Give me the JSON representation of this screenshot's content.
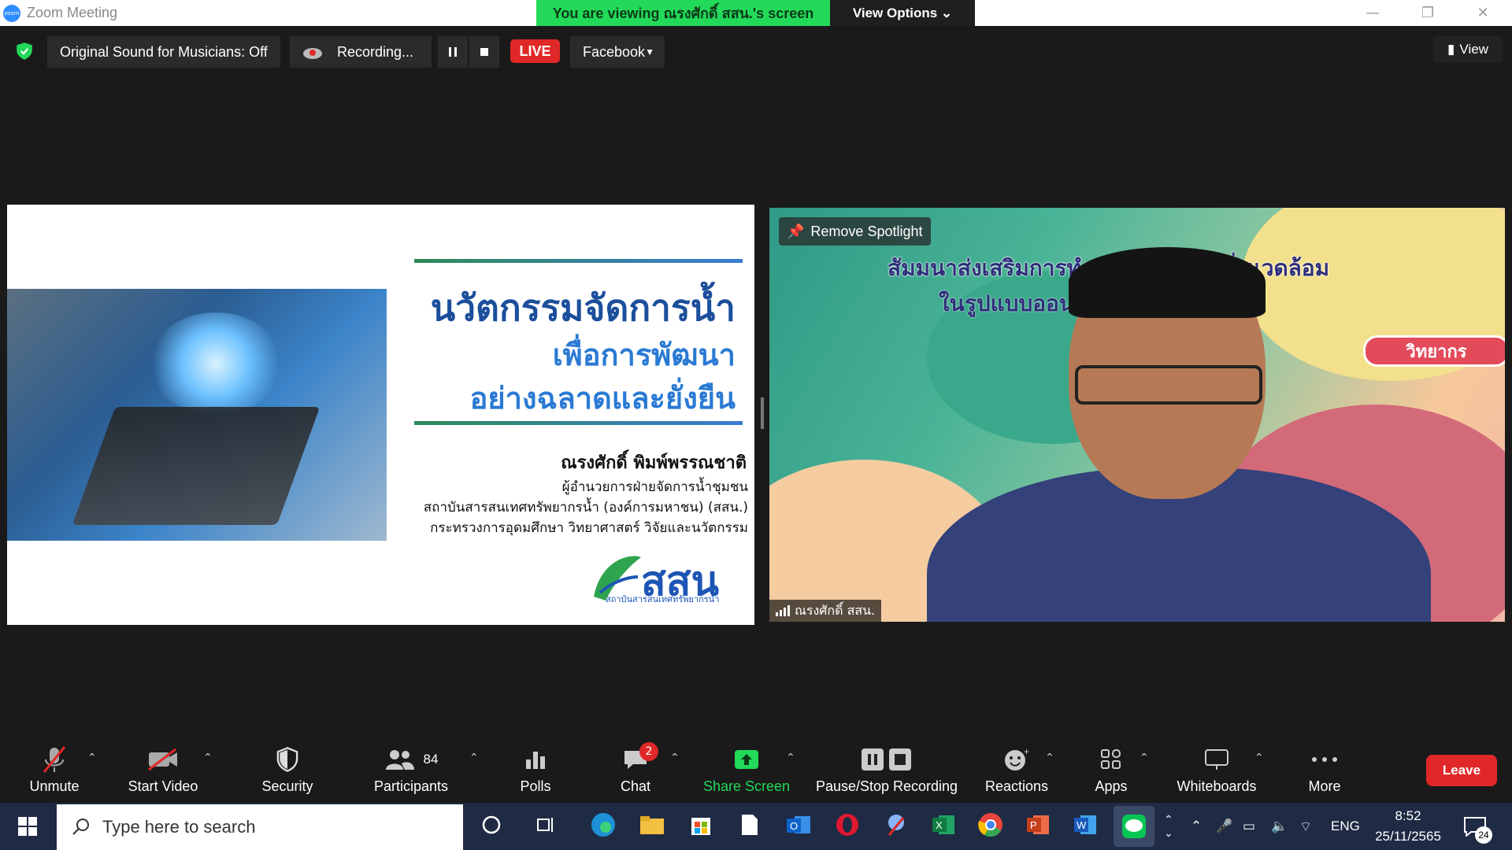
{
  "window": {
    "title": "Zoom Meeting"
  },
  "banner": {
    "viewing": "You are viewing ณรงศักดิ์ สสน.'s screen",
    "view_options": "View Options ⌄"
  },
  "topbar": {
    "original_sound": "Original Sound for Musicians: Off",
    "recording": "Recording...",
    "live": "LIVE",
    "stream_target": "Facebook",
    "view": "View"
  },
  "slide": {
    "title1": "นวัตกรรมจัดการน้ำ",
    "title2": "เพื่อการพัฒนา",
    "title3": "อย่างฉลาดและยั่งยืน",
    "presenter": "ณรงศักดิ์ พิมพ์พรรณชาติ",
    "position": "ผู้อำนวยการฝ่ายจัดการน้ำชุมชน",
    "institute": "สถาบันสารสนเทศทรัพยากรน้ำ (องค์การมหาชน) (สสน.)",
    "ministry": "กระทรวงการอุดมศึกษา วิทยาศาสตร์ วิจัยและนวัตกรรม",
    "org_logo_text": "สสน",
    "org_logo_sub": "สถาบันสารสนเทศทรัพยากรน้ำ"
  },
  "video": {
    "spotlight_label": "Remove Spotlight",
    "banner_line1": "สัมมนาส่งเสริมการทำงาน...ศาสตร์สิ่งแวดล้อม",
    "banner_line2": "ในรูปแบบออนไ...   ปี 3",
    "speaker_badge": "วิทยากร",
    "participant_name": "ณรงศักดิ์ สสน."
  },
  "toolbar": {
    "unmute": "Unmute",
    "start_video": "Start Video",
    "security": "Security",
    "participants": "Participants",
    "participants_count": "84",
    "polls": "Polls",
    "chat": "Chat",
    "chat_badge": "2",
    "share_screen": "Share Screen",
    "pause_stop": "Pause/Stop Recording",
    "reactions": "Reactions",
    "apps": "Apps",
    "whiteboards": "Whiteboards",
    "more": "More",
    "leave": "Leave"
  },
  "taskbar": {
    "search_placeholder": "Type here to search",
    "lang": "ENG",
    "time": "8:52",
    "date": "25/11/2565",
    "notif_count": "24"
  },
  "colors": {
    "zoom_blue": "#2d8cff",
    "banner_green": "#23d959",
    "leave_red": "#e02828",
    "share_green": "#23d959"
  }
}
